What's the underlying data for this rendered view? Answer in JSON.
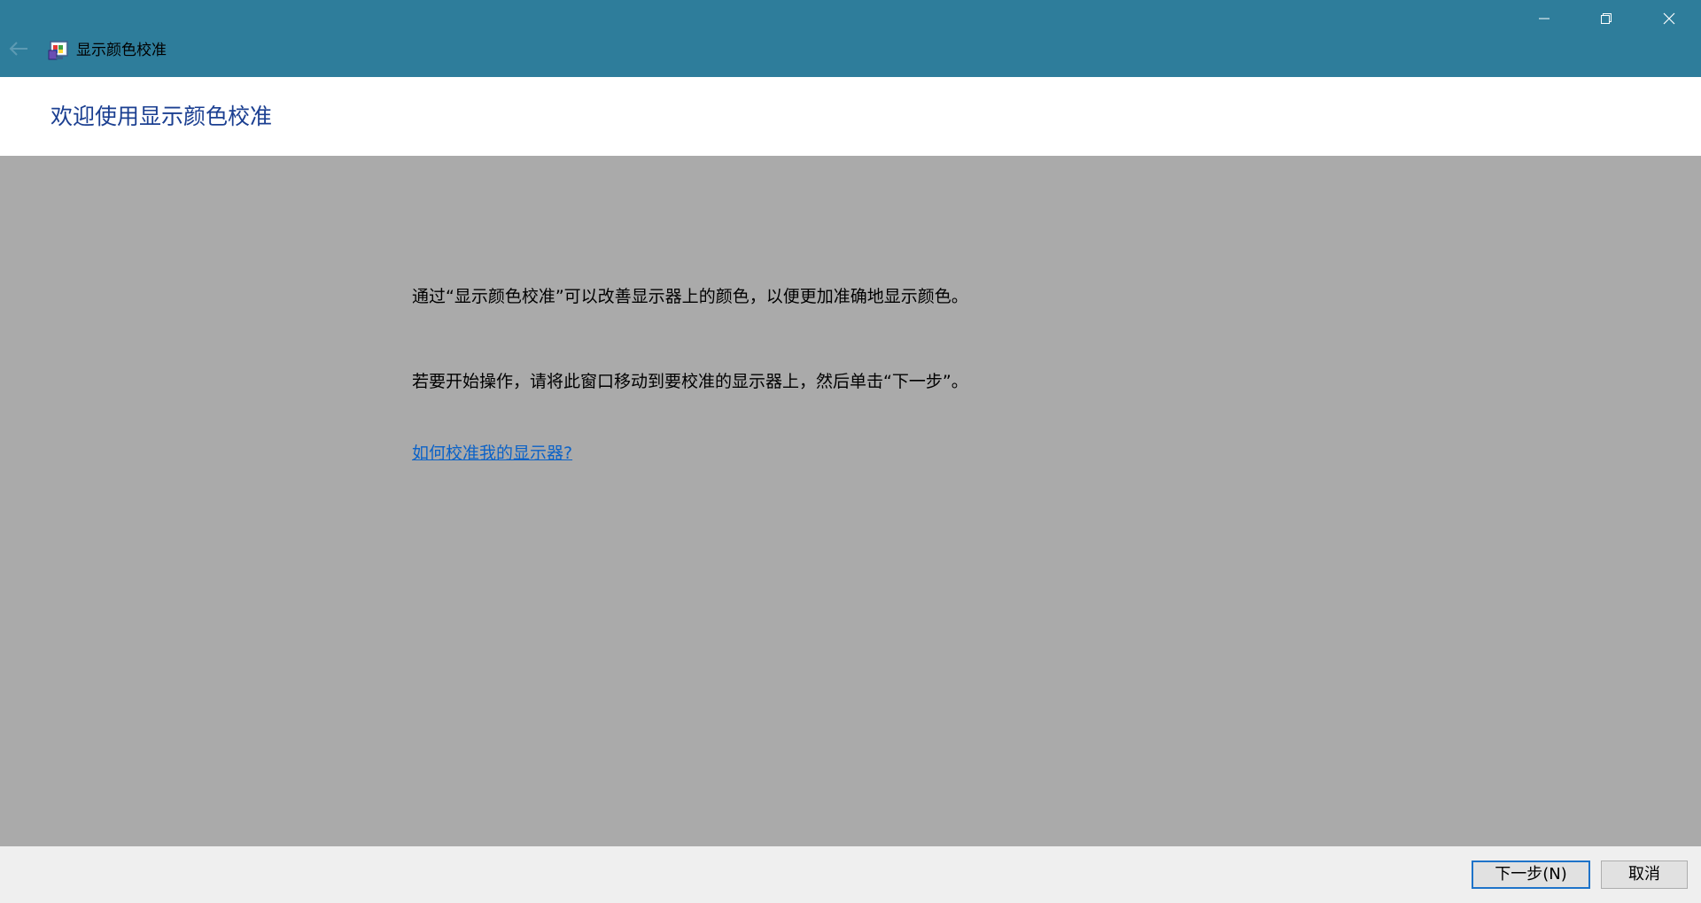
{
  "window": {
    "title": "显示颜色校准",
    "controls": {
      "minimize_icon": "minimize-icon",
      "restore_icon": "restore-icon",
      "close_icon": "close-icon"
    },
    "back_icon": "back-arrow-icon",
    "app_icon": "color-calibration-icon"
  },
  "header": {
    "title": "欢迎使用显示颜色校准"
  },
  "main": {
    "paragraph_1": "通过“显示颜色校准”可以改善显示器上的颜色，以便更加准确地显示颜色。",
    "paragraph_2": "若要开始操作，请将此窗口移动到要校准的显示器上，然后单击“下一步”。",
    "help_link": "如何校准我的显示器?"
  },
  "footer": {
    "next_label": "下一步(N)",
    "cancel_label": "取消"
  },
  "colors": {
    "titlebar": "#2e7d9b",
    "header_bg": "#ffffff",
    "content_bg": "#aaaaaa",
    "footer_bg": "#efefef",
    "title_text": "#1b3f91",
    "link": "#0b62c7",
    "default_button_border": "#1e73c9"
  }
}
